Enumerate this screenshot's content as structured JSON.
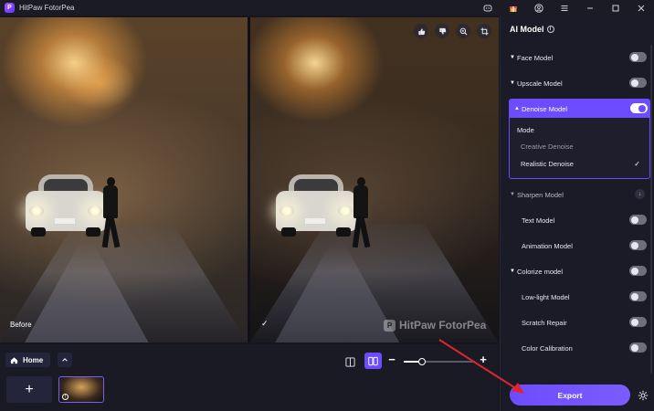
{
  "window": {
    "app_name": "HitPaw FotorPea",
    "logo_letter": "P"
  },
  "compare": {
    "before_label": "Before",
    "after_check": "✓",
    "watermark_text": "HitPaw FotorPea",
    "watermark_logo": "P"
  },
  "bottom": {
    "home_label": "Home",
    "add_label": "+",
    "zoom_minus": "−",
    "zoom_plus": "+",
    "zoom_level_fraction": 0.25
  },
  "sidebar": {
    "title": "AI Model",
    "info": "i",
    "models": [
      {
        "name": "Face Model",
        "on": false
      },
      {
        "name": "Upscale Model",
        "on": false
      },
      {
        "name": "Denoise Model",
        "on": true
      },
      {
        "name": "Sharpen Model"
      },
      {
        "name": "Text Model",
        "on": false
      },
      {
        "name": "Animation Model",
        "on": false
      },
      {
        "name": "Colorize model",
        "on": false
      },
      {
        "name": "Low-light Model",
        "on": false
      },
      {
        "name": "Scratch Repair",
        "on": false
      },
      {
        "name": "Color Calibration",
        "on": false
      }
    ],
    "denoise": {
      "mode_label": "Mode",
      "options": [
        "Creative Denoise",
        "Realistic Denoise"
      ],
      "selected": "Realistic Denoise",
      "tick": "✓"
    },
    "export_label": "Export"
  },
  "colors": {
    "accent": "#6d4cff",
    "panel_bg": "#1b1b27",
    "annotation_arrow": "#e0242f"
  },
  "icons": [
    "app-logo-icon",
    "discord-icon",
    "gift-icon",
    "user-icon",
    "menu-icon",
    "minimize-icon",
    "maximize-icon",
    "close-icon",
    "thumbs-up-icon",
    "thumbs-down-icon",
    "zoom-in-icon",
    "crop-icon",
    "home-icon",
    "chevron-up-icon",
    "single-view-icon",
    "split-view-icon",
    "info-icon",
    "gear-icon"
  ]
}
